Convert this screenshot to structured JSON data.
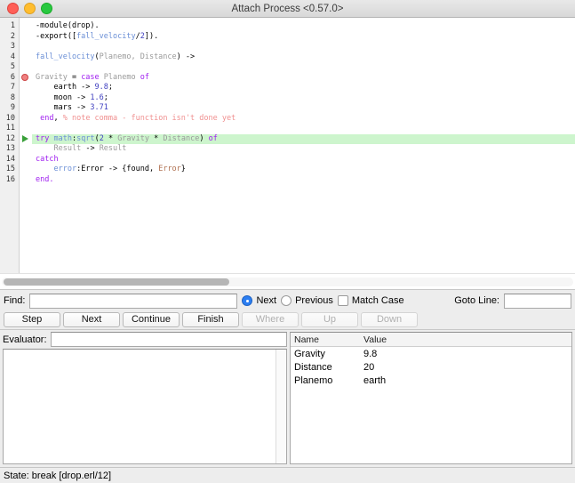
{
  "window": {
    "title": "Attach Process <0.57.0>",
    "traffic_lights": [
      "close-button",
      "minimize-button",
      "maximize-button"
    ]
  },
  "editor": {
    "line_numbers": [
      "1",
      "2",
      "3",
      "4",
      "5",
      "6",
      "7",
      "8",
      "9",
      "10",
      "11",
      "12",
      "13",
      "14",
      "15",
      "16"
    ],
    "breakpoint_line": 6,
    "current_line": 12,
    "highlight_color": "#cdf5cd",
    "lines": [
      {
        "n": "1",
        "tokens": [
          {
            "t": "-module(drop).",
            "c": "t-plain"
          }
        ]
      },
      {
        "n": "2",
        "tokens": [
          {
            "t": "-export([",
            "c": "t-plain"
          },
          {
            "t": "fall_velocity",
            "c": "t-fn"
          },
          {
            "t": "/",
            "c": "t-plain"
          },
          {
            "t": "2",
            "c": "t-num"
          },
          {
            "t": "]).",
            "c": "t-plain"
          }
        ]
      },
      {
        "n": "3",
        "tokens": [
          {
            "t": "",
            "c": "t-plain"
          }
        ]
      },
      {
        "n": "4",
        "tokens": [
          {
            "t": "fall_velocity",
            "c": "t-fn"
          },
          {
            "t": "(",
            "c": "t-plain"
          },
          {
            "t": "Planemo, Distance",
            "c": "t-var"
          },
          {
            "t": ") ->",
            "c": "t-plain"
          }
        ]
      },
      {
        "n": "5",
        "tokens": [
          {
            "t": "",
            "c": "t-plain"
          }
        ]
      },
      {
        "n": "6",
        "tokens": [
          {
            "t": "Gravity",
            "c": "t-var"
          },
          {
            "t": " = ",
            "c": "t-plain"
          },
          {
            "t": "case",
            "c": "t-kw"
          },
          {
            "t": " ",
            "c": "t-plain"
          },
          {
            "t": "Planemo",
            "c": "t-var"
          },
          {
            "t": " ",
            "c": "t-plain"
          },
          {
            "t": "of",
            "c": "t-kw"
          }
        ]
      },
      {
        "n": "7",
        "tokens": [
          {
            "t": "    earth -> ",
            "c": "t-plain"
          },
          {
            "t": "9.8",
            "c": "t-num"
          },
          {
            "t": ";",
            "c": "t-plain"
          }
        ]
      },
      {
        "n": "8",
        "tokens": [
          {
            "t": "    moon -> ",
            "c": "t-plain"
          },
          {
            "t": "1.6",
            "c": "t-num"
          },
          {
            "t": ";",
            "c": "t-plain"
          }
        ]
      },
      {
        "n": "9",
        "tokens": [
          {
            "t": "    mars -> ",
            "c": "t-plain"
          },
          {
            "t": "3.71",
            "c": "t-num"
          }
        ]
      },
      {
        "n": "10",
        "tokens": [
          {
            "t": " ",
            "c": "t-plain"
          },
          {
            "t": "end",
            "c": "t-kw"
          },
          {
            "t": ", ",
            "c": "t-plain"
          },
          {
            "t": "% note comma - function isn't done yet",
            "c": "t-cmt"
          }
        ]
      },
      {
        "n": "11",
        "tokens": [
          {
            "t": "",
            "c": "t-plain"
          }
        ]
      },
      {
        "n": "12",
        "tokens": [
          {
            "t": "try",
            "c": "t-kw"
          },
          {
            "t": " ",
            "c": "t-plain"
          },
          {
            "t": "math",
            "c": "t-mod"
          },
          {
            "t": ":",
            "c": "t-plain"
          },
          {
            "t": "sqrt",
            "c": "t-mod"
          },
          {
            "t": "(",
            "c": "t-plain"
          },
          {
            "t": "2",
            "c": "t-num"
          },
          {
            "t": " * ",
            "c": "t-plain"
          },
          {
            "t": "Gravity",
            "c": "t-var"
          },
          {
            "t": " * ",
            "c": "t-plain"
          },
          {
            "t": "Distance",
            "c": "t-var"
          },
          {
            "t": ") ",
            "c": "t-plain"
          },
          {
            "t": "of",
            "c": "t-kw"
          }
        ],
        "highlight": true
      },
      {
        "n": "13",
        "tokens": [
          {
            "t": "    ",
            "c": "t-plain"
          },
          {
            "t": "Result",
            "c": "t-var"
          },
          {
            "t": " -> ",
            "c": "t-plain"
          },
          {
            "t": "Result",
            "c": "t-var"
          }
        ]
      },
      {
        "n": "14",
        "tokens": [
          {
            "t": "catch",
            "c": "t-kw"
          }
        ]
      },
      {
        "n": "15",
        "tokens": [
          {
            "t": "    ",
            "c": "t-plain"
          },
          {
            "t": "error",
            "c": "t-fn"
          },
          {
            "t": ":Error -> {found, ",
            "c": "t-plain"
          },
          {
            "t": "Error",
            "c": "t-atom"
          },
          {
            "t": "}",
            "c": "t-plain"
          }
        ]
      },
      {
        "n": "16",
        "tokens": [
          {
            "t": "end.",
            "c": "t-kw"
          }
        ]
      }
    ]
  },
  "find_bar": {
    "find_label": "Find:",
    "find_value": "",
    "next_label": "Next",
    "next_selected": true,
    "previous_label": "Previous",
    "previous_selected": false,
    "match_case_label": "Match Case",
    "match_case_checked": false,
    "goto_line_label": "Goto Line:",
    "goto_line_value": ""
  },
  "buttons": [
    {
      "label": "Step",
      "enabled": true
    },
    {
      "label": "Next",
      "enabled": true
    },
    {
      "label": "Continue",
      "enabled": true
    },
    {
      "label": "Finish",
      "enabled": true
    },
    {
      "label": "Where",
      "enabled": false
    },
    {
      "label": "Up",
      "enabled": false
    },
    {
      "label": "Down",
      "enabled": false
    }
  ],
  "evaluator": {
    "label": "Evaluator:",
    "input_value": "",
    "output_value": ""
  },
  "bindings": {
    "columns": [
      "Name",
      "Value"
    ],
    "rows": [
      {
        "name": "Gravity",
        "value": "9.8"
      },
      {
        "name": "Distance",
        "value": "20"
      },
      {
        "name": "Planemo",
        "value": "earth"
      }
    ]
  },
  "status_bar": {
    "text": "State: break [drop.erl/12]"
  }
}
